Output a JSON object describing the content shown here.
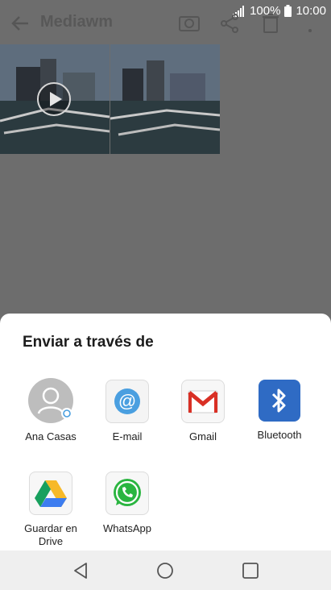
{
  "status_bar": {
    "battery": "100%",
    "time": "10:00"
  },
  "app_bar": {
    "title": "Mediawm"
  },
  "share_sheet": {
    "title": "Enviar a través de",
    "targets": [
      {
        "label": "Ana Casas",
        "icon": "contact-avatar-icon"
      },
      {
        "label": "E-mail",
        "icon": "email-at-icon"
      },
      {
        "label": "Gmail",
        "icon": "gmail-icon"
      },
      {
        "label": "Bluetooth",
        "icon": "bluetooth-icon"
      },
      {
        "label": "Guardar en Drive",
        "icon": "google-drive-icon"
      },
      {
        "label": "WhatsApp",
        "icon": "whatsapp-icon"
      }
    ]
  },
  "colors": {
    "bluetooth": "#2f6bc4",
    "whatsapp": "#2ab540",
    "gmail_red": "#d93025",
    "email_blue": "#4a9fe0"
  }
}
